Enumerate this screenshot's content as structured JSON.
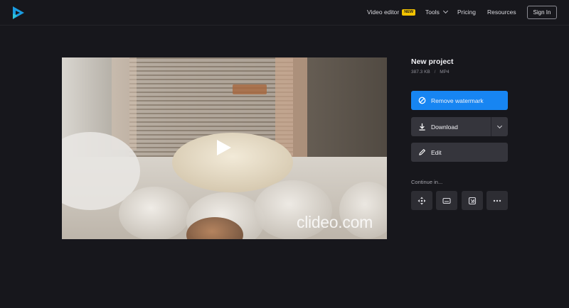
{
  "header": {
    "logo": "clideo-logo-icon",
    "nav": {
      "video_editor": "Video editor",
      "new_badge": "NEW",
      "tools": "Tools",
      "pricing": "Pricing",
      "resources": "Resources"
    },
    "sign_in": "Sign In"
  },
  "video": {
    "watermark": "clideo.com",
    "play_icon": "play-icon"
  },
  "project": {
    "title": "New project",
    "size": "387.3 KB",
    "separator": "/",
    "format": "MP4"
  },
  "actions": {
    "remove_watermark": "Remove watermark",
    "download": "Download",
    "edit": "Edit"
  },
  "continue": {
    "label": "Continue in...",
    "tools": [
      "move-icon",
      "subtitle-icon",
      "crop-icon",
      "more-icon"
    ]
  },
  "colors": {
    "background": "#17171c",
    "primary": "#1785f2",
    "button_dark": "#35353c",
    "badge": "#f2c200"
  }
}
